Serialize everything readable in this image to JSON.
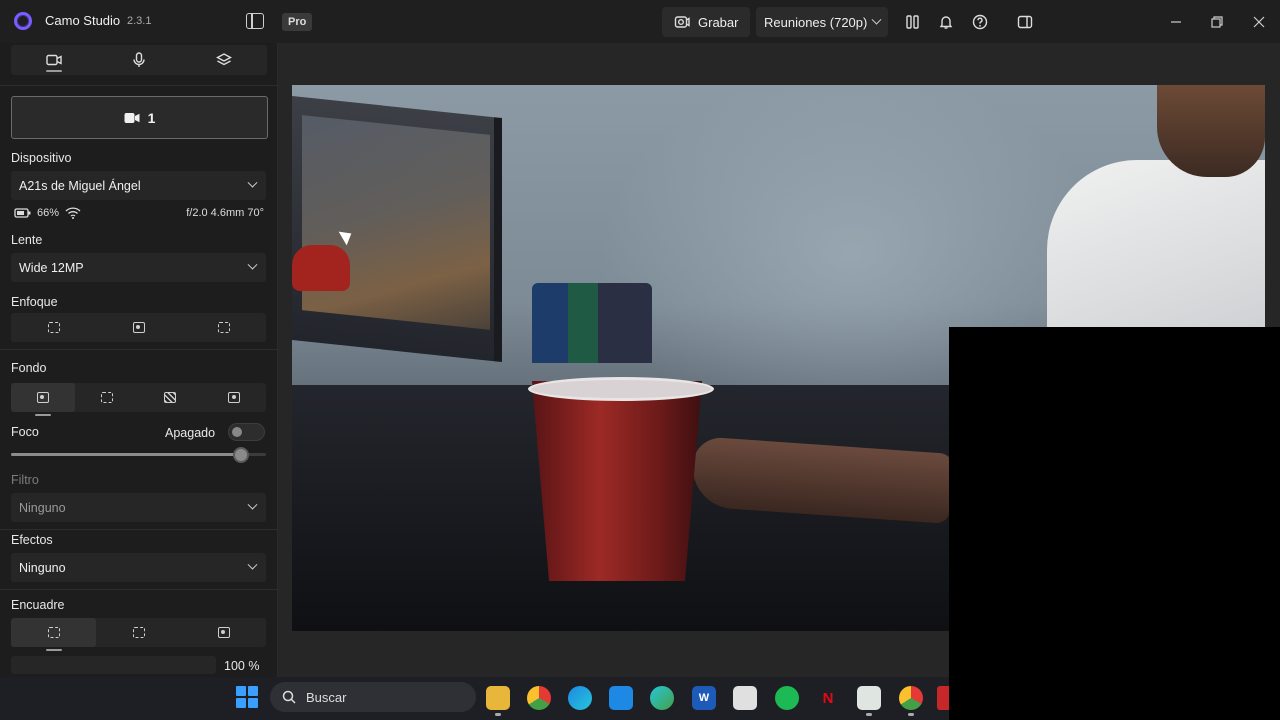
{
  "titlebar": {
    "app_name": "Camo Studio",
    "version": "2.3.1",
    "pro_badge": "Pro",
    "record_label": "Grabar",
    "preset_label": "Reuniones (720p)"
  },
  "sidebar": {
    "tabs": [
      "video-camera-icon",
      "microphone-icon",
      "layers-icon"
    ],
    "camera_label": "1",
    "device": {
      "label": "Dispositivo",
      "value": "A21s de Miguel Ángel",
      "battery": "66%",
      "lens_info": "f/2.0 4.6mm 70°"
    },
    "lens": {
      "label": "Lente",
      "value": "Wide 12MP"
    },
    "focus": {
      "label": "Enfoque"
    },
    "background": {
      "label": "Fondo",
      "focus_label": "Foco",
      "focus_state": "Apagado",
      "focus_level": 0.9,
      "filter_label": "Filtro",
      "filter_value": "Ninguno"
    },
    "effects": {
      "label": "Efectos",
      "value": "Ninguno"
    },
    "framing": {
      "label": "Encuadre",
      "zoom": "100 %"
    }
  },
  "taskbar": {
    "search_placeholder": "Buscar",
    "apps": [
      "file-explorer-icon",
      "chrome-icon",
      "edge-icon",
      "store-icon",
      "edge-dev-icon",
      "word-icon",
      "snipping-tool-icon",
      "spotify-icon",
      "netflix-icon",
      "camo-icon",
      "chrome-2-icon",
      "app-icon"
    ]
  },
  "colors": {
    "accent": "#7b5cff",
    "background": "#1f1f1f",
    "panel": "#262626"
  }
}
